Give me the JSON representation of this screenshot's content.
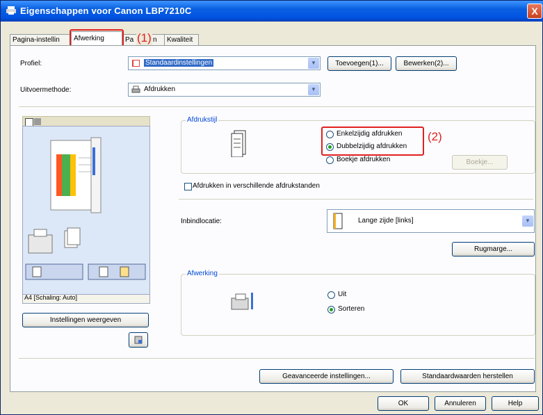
{
  "window": {
    "title": "Eigenschappen voor Canon LBP7210C",
    "close_label": "X"
  },
  "tabs": [
    {
      "label": "Pagina-instellin"
    },
    {
      "label": "Afwerking"
    },
    {
      "label": "Pa"
    },
    {
      "label": "Kwaliteit"
    }
  ],
  "tabs_hidden_fragment": "n",
  "callouts": {
    "one": "(1)",
    "two": "(2)",
    "color": "#e02020"
  },
  "profile": {
    "label": "Profiel:",
    "value": "Standaardinstellingen",
    "add_button": "Toevoegen(1)...",
    "edit_button": "Bewerken(2)..."
  },
  "output_method": {
    "label": "Uitvoermethode:",
    "value": "Afdrukken"
  },
  "preview": {
    "status": "A4 [Schaling: Auto]",
    "view_settings_button": "Instellingen weergeven"
  },
  "print_style": {
    "title": "Afdrukstijl",
    "options": [
      {
        "label": "Enkelzijdig afdrukken",
        "selected": false
      },
      {
        "label": "Dubbelzijdig afdrukken",
        "selected": true
      },
      {
        "label": "Boekje afdrukken",
        "selected": false
      }
    ],
    "booklet_button": "Boekje..."
  },
  "orientation_checkbox": {
    "label": "Afdrukken in verschillende afdrukstanden",
    "checked": false
  },
  "binding": {
    "label": "Inbindlocatie:",
    "value": "Lange zijde [links]",
    "margin_button": "Rugmarge..."
  },
  "finishing": {
    "title": "Afwerking",
    "options": [
      {
        "label": "Uit",
        "selected": false
      },
      {
        "label": "Sorteren",
        "selected": true
      }
    ]
  },
  "footer": {
    "advanced_button": "Geavanceerde instellingen...",
    "restore_button": "Standaardwaarden herstellen",
    "ok_button": "OK",
    "cancel_button": "Annuleren",
    "help_button": "Help"
  }
}
